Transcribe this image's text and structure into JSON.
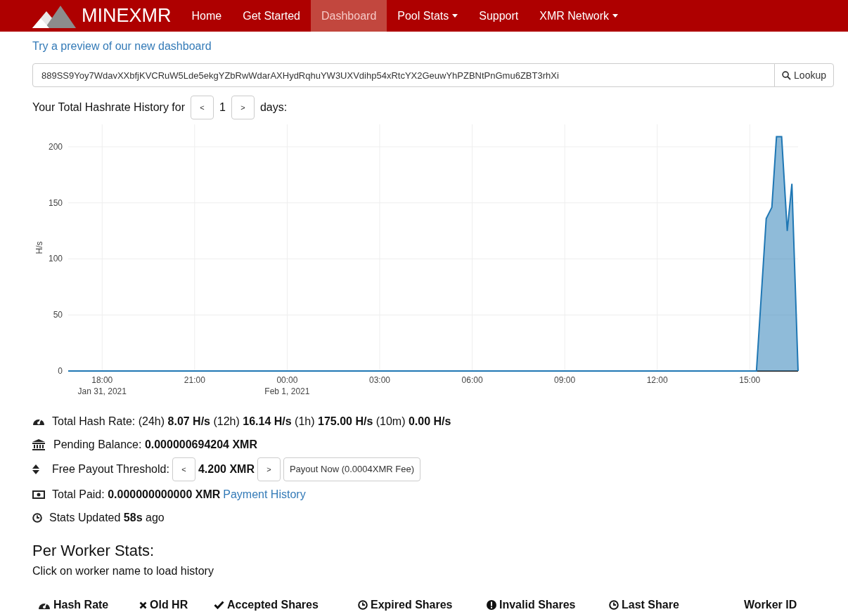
{
  "navbar": {
    "brand": "MINEXMR",
    "items": [
      {
        "label": "Home",
        "selected": false,
        "dropdown": false
      },
      {
        "label": "Get Started",
        "selected": false,
        "dropdown": false
      },
      {
        "label": "Dashboard",
        "selected": true,
        "dropdown": false
      },
      {
        "label": "Pool Stats",
        "selected": false,
        "dropdown": true
      },
      {
        "label": "Support",
        "selected": false,
        "dropdown": false
      },
      {
        "label": "XMR Network",
        "selected": false,
        "dropdown": true
      }
    ]
  },
  "preview_link": "Try a preview of our new dashboard",
  "lookup": {
    "value": "889SS9Yoy7WdavXXbfjKVCRuW5Lde5ekgYZbRwWdarAXHydRqhuYW3UXVdihp54xRtcYX2GeuwYhPZBNtPnGmu6ZBT3rhXi",
    "button": "Lookup"
  },
  "history": {
    "label": "Your Total Hashrate History for",
    "prev": "<",
    "days": "1",
    "next": ">",
    "suffix": "days:",
    "chart_data": {
      "type": "area",
      "ylabel": "H/s",
      "x": [
        "2021-01-31T16:54",
        "2021-02-01T15:13",
        "2021-02-01T15:32",
        "2021-02-01T15:43",
        "2021-02-01T15:52",
        "2021-02-01T16:02",
        "2021-02-01T16:13",
        "2021-02-01T16:22",
        "2021-02-01T16:34"
      ],
      "series": [
        {
          "color": "#1f77b4",
          "values": [
            0,
            0,
            136,
            146,
            209,
            209,
            125,
            167,
            0
          ]
        }
      ],
      "xlim": [
        "2021-01-31T16:54",
        "2021-02-01T16:34"
      ],
      "ylim": [
        0,
        220
      ],
      "xticks": [
        {
          "value": "2021-01-31T18:00",
          "label": "18:00 Jan 31, 2021"
        },
        {
          "value": "2021-01-31T21:00",
          "label": "21:00"
        },
        {
          "value": "2021-02-01T00:00",
          "label": "00:00 Feb 1, 2021"
        },
        {
          "value": "2021-02-01T03:00",
          "label": "03:00"
        },
        {
          "value": "2021-02-01T06:00",
          "label": "06:00"
        },
        {
          "value": "2021-02-01T09:00",
          "label": "09:00"
        },
        {
          "value": "2021-02-01T12:00",
          "label": "12:00"
        },
        {
          "value": "2021-02-01T15:00",
          "label": "15:00"
        }
      ],
      "yticks": [
        0,
        50,
        100,
        150,
        200
      ],
      "grid": true
    }
  },
  "stats": {
    "hash_rate": "Total Hash Rate: (24h) **8.07 H/s** (12h) **16.14 H/s** (1h) **175.00 H/s** (10m) **0.00 H/s**",
    "pending": "Pending Balance: **0.000000694204 XMR**",
    "threshold": {
      "label": "Free Payout Threshold:",
      "prev": "<",
      "value": "4.200 XMR",
      "next": ">",
      "payout_button": "Payout Now (0.0004XMR Fee)"
    },
    "total_paid": "Total Paid: **0.000000000000 XMR**",
    "payment_history": "Payment History",
    "updated": "Stats Updated **58s** ago"
  },
  "workers": {
    "title": "Per Worker Stats:",
    "hint": "Click on worker name to load history",
    "columns": [
      "Hash Rate",
      "Old HR",
      "Accepted Shares",
      "Expired Shares",
      "Invalid Shares",
      "Last Share",
      "Worker ID"
    ]
  }
}
